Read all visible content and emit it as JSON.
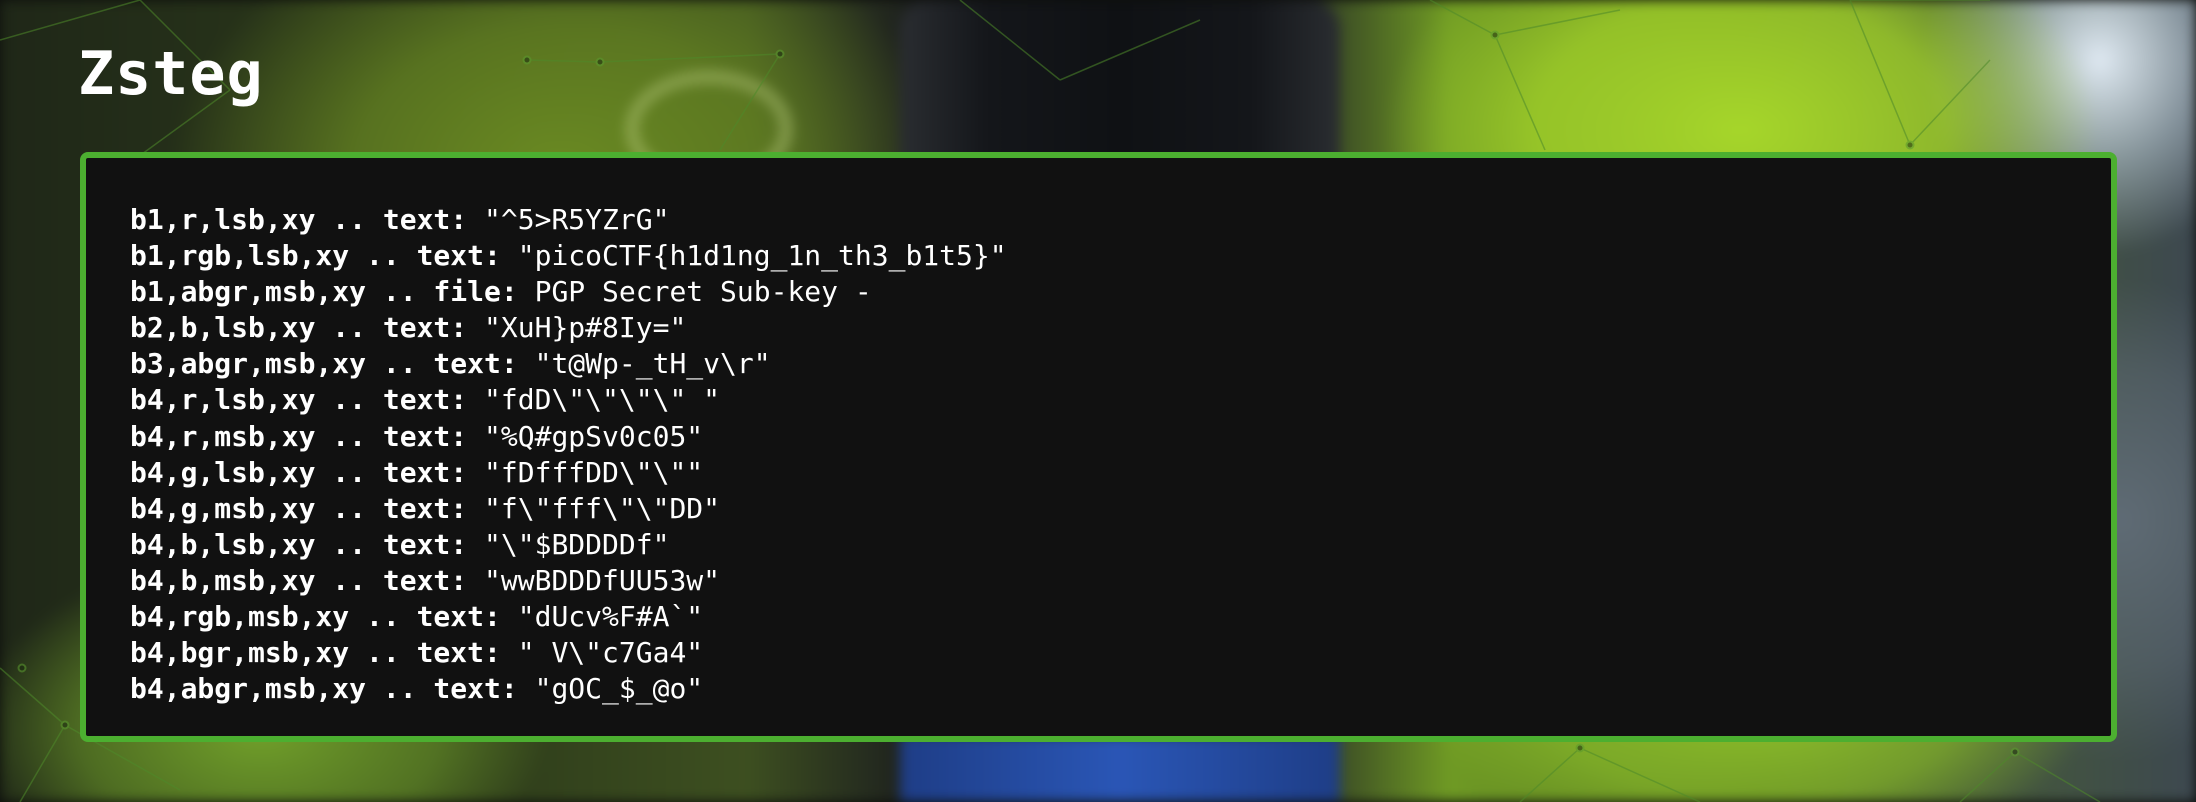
{
  "slide": {
    "title": "Zsteg"
  },
  "terminal": {
    "lines": [
      {
        "key": "b1,r,lsb,xy .. text:",
        "value": " \"^5>R5YZrG\""
      },
      {
        "key": "b1,rgb,lsb,xy .. text:",
        "value": " \"picoCTF{h1d1ng_1n_th3_b1t5}\""
      },
      {
        "key": "b1,abgr,msb,xy .. file:",
        "value": " PGP Secret Sub-key -"
      },
      {
        "key": "b2,b,lsb,xy .. text:",
        "value": " \"XuH}p#8Iy=\""
      },
      {
        "key": "b3,abgr,msb,xy .. text:",
        "value": " \"t@Wp-_tH_v\\r\""
      },
      {
        "key": "b4,r,lsb,xy .. text:",
        "value": " \"fdD\\\"\\\"\\\"\\\" \""
      },
      {
        "key": "b4,r,msb,xy .. text:",
        "value": " \"%Q#gpSv0c05\""
      },
      {
        "key": "b4,g,lsb,xy .. text:",
        "value": " \"fDfffDD\\\"\\\"\""
      },
      {
        "key": "b4,g,msb,xy .. text:",
        "value": " \"f\\\"fff\\\"\\\"DD\""
      },
      {
        "key": "b4,b,lsb,xy .. text:",
        "value": " \"\\\"$BDDDDf\""
      },
      {
        "key": "b4,b,msb,xy .. text:",
        "value": " \"wwBDDDfUU53w\""
      },
      {
        "key": "b4,rgb,msb,xy .. text:",
        "value": " \"dUcv%F#A`\""
      },
      {
        "key": "b4,bgr,msb,xy .. text:",
        "value": " \" V\\\"c7Ga4\""
      },
      {
        "key": "b4,abgr,msb,xy .. text:",
        "value": " \"gOC_$_@o\""
      }
    ]
  },
  "colors": {
    "panel_background": "#111111",
    "panel_border": "#4caf30",
    "text": "#ffffff"
  }
}
